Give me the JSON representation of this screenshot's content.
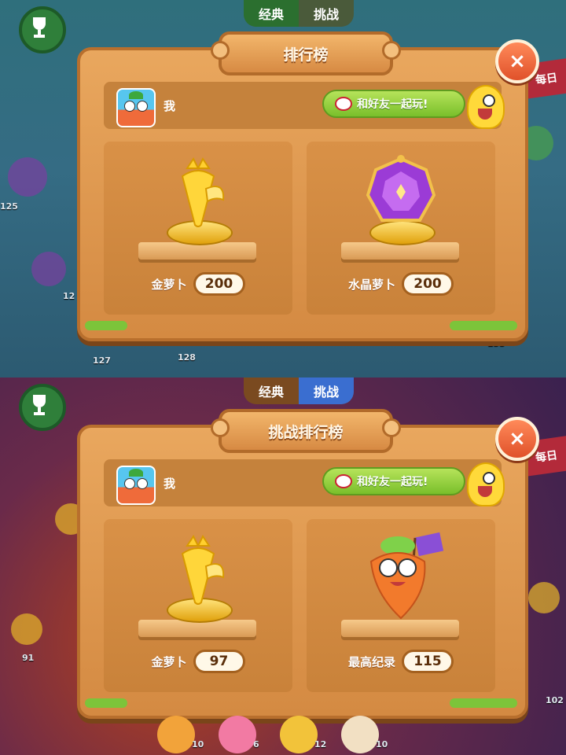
{
  "screens": [
    {
      "mode_tabs": [
        {
          "label": "经典",
          "active": true
        },
        {
          "label": "挑战",
          "active": false
        }
      ],
      "title": "排行榜",
      "close_label": "×",
      "user_name": "我",
      "play_button": "和好友一起玩!",
      "cards": [
        {
          "label": "金萝卜",
          "value": "200",
          "icon": "gold-carrot-trophy-icon"
        },
        {
          "label": "水晶萝卜",
          "value": "200",
          "icon": "crystal-gem-trophy-icon"
        }
      ],
      "bg_numbers": [
        "125",
        "127",
        "128",
        "133",
        "12"
      ],
      "daily_tag": "每日"
    },
    {
      "mode_tabs": [
        {
          "label": "经典",
          "active": false
        },
        {
          "label": "挑战",
          "active": true
        }
      ],
      "title": "挑战排行榜",
      "close_label": "×",
      "user_name": "我",
      "play_button": "和好友一起玩!",
      "cards": [
        {
          "label": "金萝卜",
          "value": "97",
          "icon": "gold-carrot-trophy-icon"
        },
        {
          "label": "最高纪录",
          "value": "115",
          "icon": "carrot-hero-flag-icon"
        }
      ],
      "bg_numbers": [
        "91",
        "102",
        "10",
        "6",
        "12",
        "10"
      ],
      "daily_tag": "每日"
    }
  ],
  "colors": {
    "panel": "#e9a75e",
    "panel_border": "#b86f2d",
    "close_button": "#e0512a",
    "play_button": "#79bf2b"
  }
}
